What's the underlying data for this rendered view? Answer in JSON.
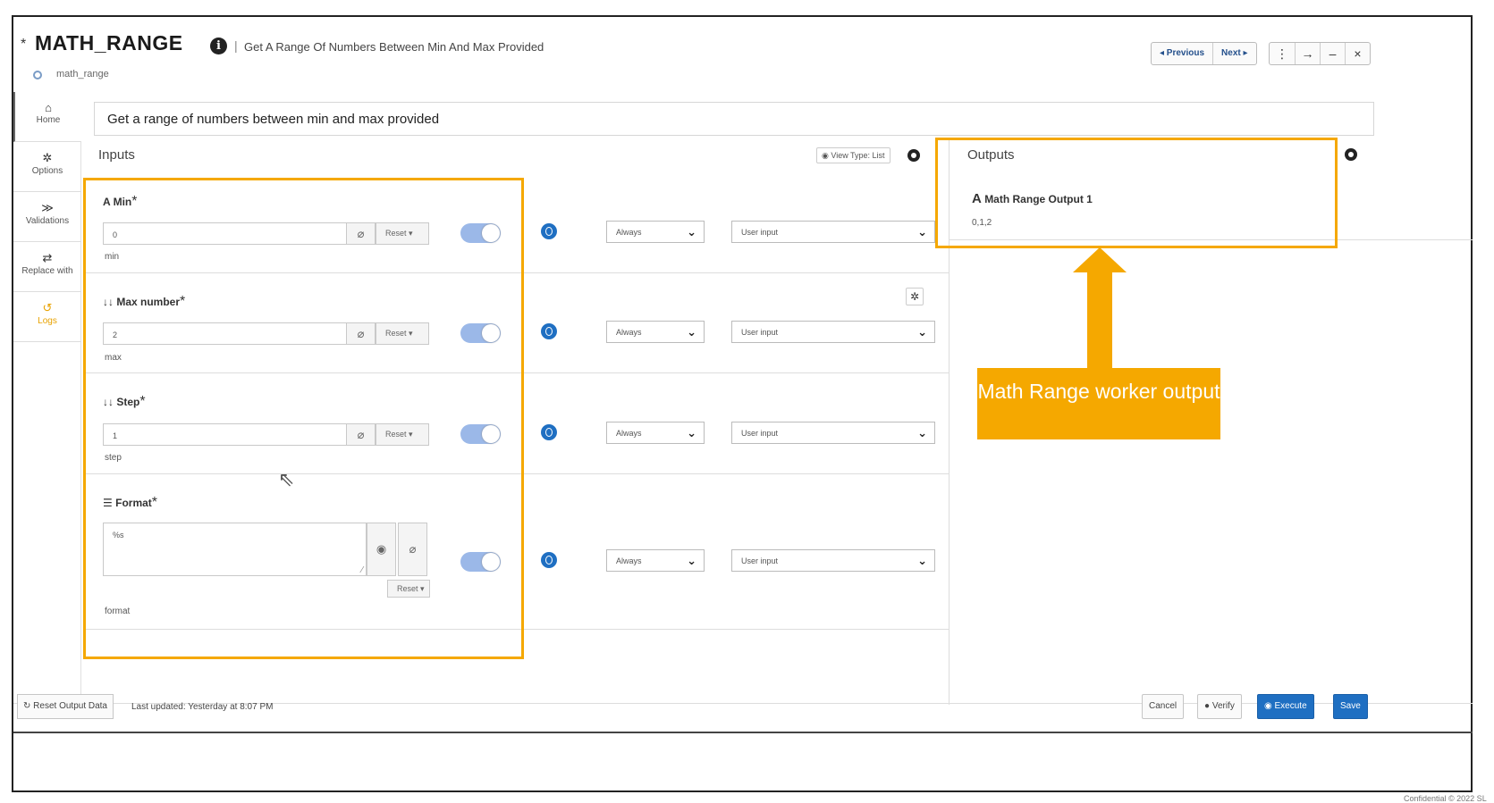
{
  "header": {
    "dirty_marker": "*",
    "title": "MATH_RANGE",
    "info_icon": "info-icon",
    "separator": "|",
    "subtitle": "Get A Range Of Numbers Between Min And Max Provided",
    "slug": "math_range",
    "prev_label": "◂ Previous",
    "next_label": "Next ▸",
    "kebab_glyph": "⋮",
    "forward_glyph": "→",
    "minimize_glyph": "–",
    "close_glyph": "×"
  },
  "sidebar": {
    "items": [
      {
        "icon": "home-icon",
        "glyph": "⌂",
        "label": "Home"
      },
      {
        "icon": "gear-icon",
        "glyph": "✲",
        "label": "Options"
      },
      {
        "icon": "validations-icon",
        "glyph": "≫",
        "label": "Validations"
      },
      {
        "icon": "swap-icon",
        "glyph": "⇄",
        "label": "Replace with"
      },
      {
        "icon": "history-icon",
        "glyph": "↺",
        "label": "Logs"
      }
    ]
  },
  "description": "Get a range of numbers between min and max provided",
  "inputs": {
    "title": "Inputs",
    "view_type": "View Type: List",
    "rows": [
      {
        "type_glyph": "A",
        "label": "Min",
        "value": "0",
        "sub": "min",
        "reset": "Reset ▾",
        "when": "Always",
        "source": "User input"
      },
      {
        "type_glyph": "↓↓",
        "label": "Max number",
        "value": "2",
        "sub": "max",
        "reset": "Reset ▾",
        "when": "Always",
        "source": "User input"
      },
      {
        "type_glyph": "↓↓",
        "label": "Step",
        "value": "1",
        "sub": "step",
        "reset": "Reset ▾",
        "when": "Always",
        "source": "User input"
      },
      {
        "type_glyph": "☰",
        "label": "Format",
        "value": "%s",
        "sub": "format",
        "reset": "Reset ▾",
        "when": "Always",
        "source": "User input"
      }
    ],
    "required_marker": "*"
  },
  "outputs": {
    "title": "Outputs",
    "items": [
      {
        "type_glyph": "A",
        "name": "Math Range Output 1",
        "value": "0,1,2"
      }
    ]
  },
  "callout": {
    "text": "Math Range worker output",
    "color": "#f5a800"
  },
  "footer": {
    "reset_output": "Reset Output Data",
    "last_updated": "Last updated: Yesterday at 8:07 PM",
    "cancel": "Cancel",
    "verify": "Verify",
    "execute": "Execute",
    "save": "Save"
  },
  "confidential": "Confidential © 2022 SL"
}
